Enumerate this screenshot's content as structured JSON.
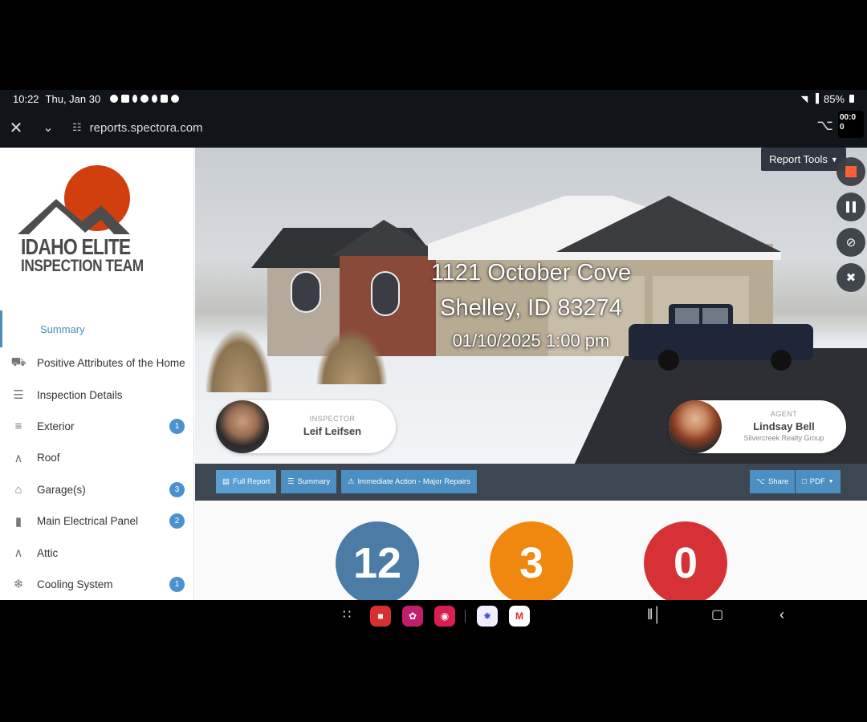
{
  "status": {
    "time": "10:22",
    "date": "Thu, Jan 30",
    "battery": "85%"
  },
  "browser": {
    "url": "reports.spectora.com",
    "timer": "00:0 0"
  },
  "logo": {
    "line1": "IDAHO ELITE",
    "line2": "INSPECTION TEAM"
  },
  "sidebar": {
    "items": [
      {
        "label": "Summary",
        "badge": ""
      },
      {
        "label": "Positive Attributes of the Home",
        "badge": ""
      },
      {
        "label": "Inspection Details",
        "badge": ""
      },
      {
        "label": "Exterior",
        "badge": "1"
      },
      {
        "label": "Roof",
        "badge": ""
      },
      {
        "label": "Garage(s)",
        "badge": "3"
      },
      {
        "label": "Main Electrical Panel",
        "badge": "2"
      },
      {
        "label": "Attic",
        "badge": ""
      },
      {
        "label": "Cooling System",
        "badge": "1"
      }
    ]
  },
  "hero": {
    "address1": "1121 October Cove",
    "address2": "Shelley, ID 83274",
    "datetime": "01/10/2025 1:00 pm"
  },
  "inspector": {
    "role": "INSPECTOR",
    "name": "Leif Leifsen"
  },
  "agent": {
    "role": "AGENT",
    "name": "Lindsay Bell",
    "company": "Silvercreek Realty Group"
  },
  "report_tools": {
    "label": "Report Tools"
  },
  "toolbar": {
    "full_report": "Full Report",
    "summary": "Summary",
    "immediate": "Immediate Action - Major Repairs",
    "share": "Share",
    "pdf": "PDF"
  },
  "counters": {
    "blue": "12",
    "orange": "3",
    "red": "0",
    "colors": {
      "blue": "#4a7ca5",
      "orange": "#f0880f",
      "red": "#d63235"
    }
  },
  "icons": {
    "close": "close-icon",
    "chevron": "chevron-down-icon",
    "share": "share-icon"
  }
}
